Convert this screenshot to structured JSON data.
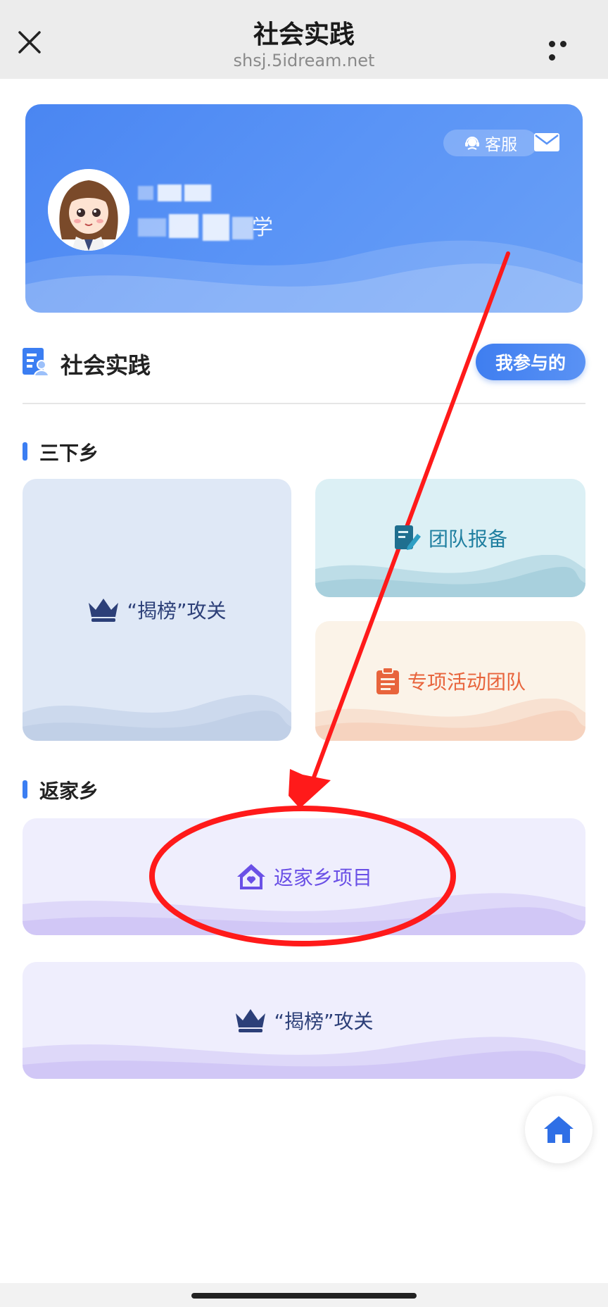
{
  "navbar": {
    "title": "社会实践",
    "url": "shsj.5idream.net"
  },
  "profile": {
    "service_label": "客服",
    "name_tail": "学"
  },
  "section": {
    "title": "社会实践",
    "my_button": "我参与的"
  },
  "sanxiaxiang": {
    "label": "三下乡",
    "tiles": {
      "jiebang": "“揭榜”攻关",
      "team": "团队报备",
      "special": "专项活动团队"
    }
  },
  "fanjiaxiang": {
    "label": "返家乡",
    "tiles": {
      "project": "返家乡项目",
      "jiebang": "“揭榜”攻关"
    }
  },
  "colors": {
    "primary": "#3b7ef2",
    "team_text": "#1f7fa0",
    "special_text": "#e8643c",
    "return_text": "#6a50e6",
    "crown": "#2c3f78",
    "annotation_red": "#ff1a1a"
  },
  "icons": [
    "close-icon",
    "more-icon",
    "headset-icon",
    "mail-icon",
    "social-practice-icon",
    "crown-icon",
    "team-report-icon",
    "clipboard-icon",
    "home-icon"
  ]
}
